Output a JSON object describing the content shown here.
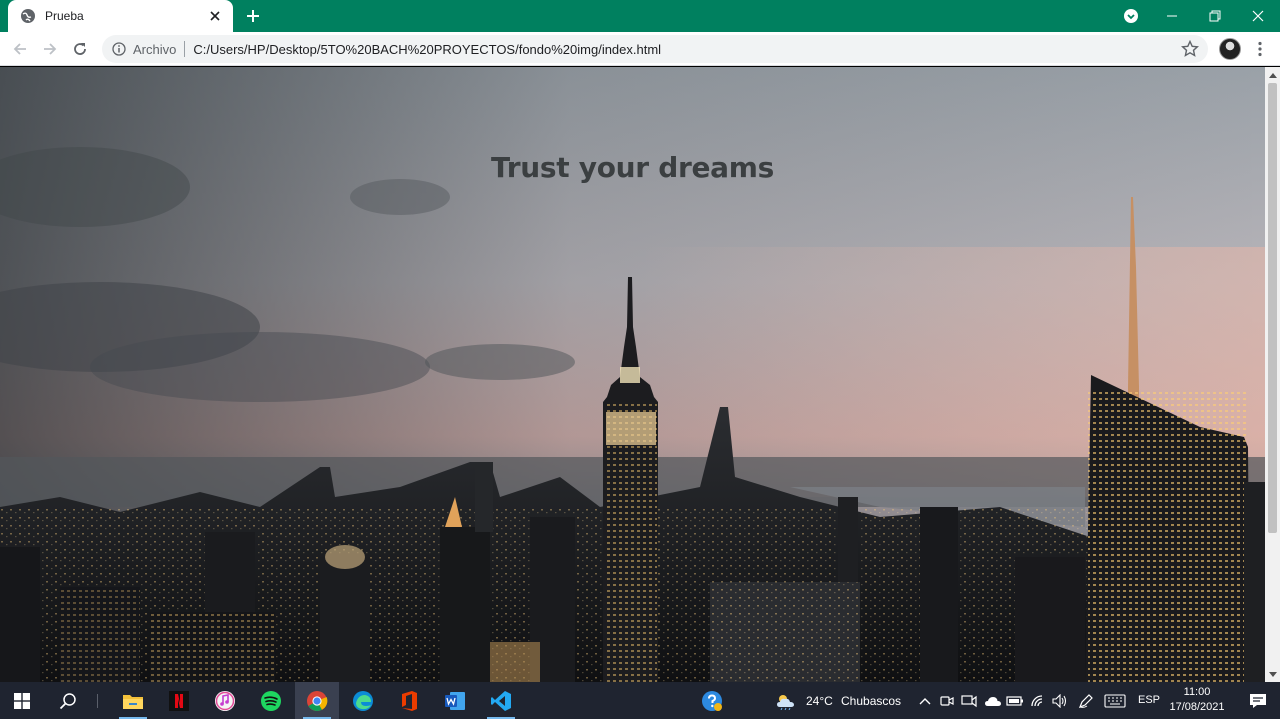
{
  "browser": {
    "tab_title": "Prueba",
    "new_tab_label": "+",
    "omnibox": {
      "scheme_label": "Archivo",
      "url": "C:/Users/HP/Desktop/5TO%20BACH%20PROYECTOS/fondo%20img/index.html"
    },
    "theme_color": "#00805f"
  },
  "page": {
    "headline": "Trust your dreams",
    "background": "night city skyline photo"
  },
  "taskbar": {
    "apps": [
      "start-icon",
      "search-icon",
      "file-explorer-icon",
      "netflix-icon",
      "itunes-icon",
      "spotify-icon",
      "chrome-icon",
      "edge-icon",
      "office-icon",
      "word-icon",
      "vscode-icon"
    ],
    "weather_temp": "24°C",
    "weather_desc": "Chubascos",
    "language": "ESP",
    "time": "11:00",
    "date": "17/08/2021"
  }
}
